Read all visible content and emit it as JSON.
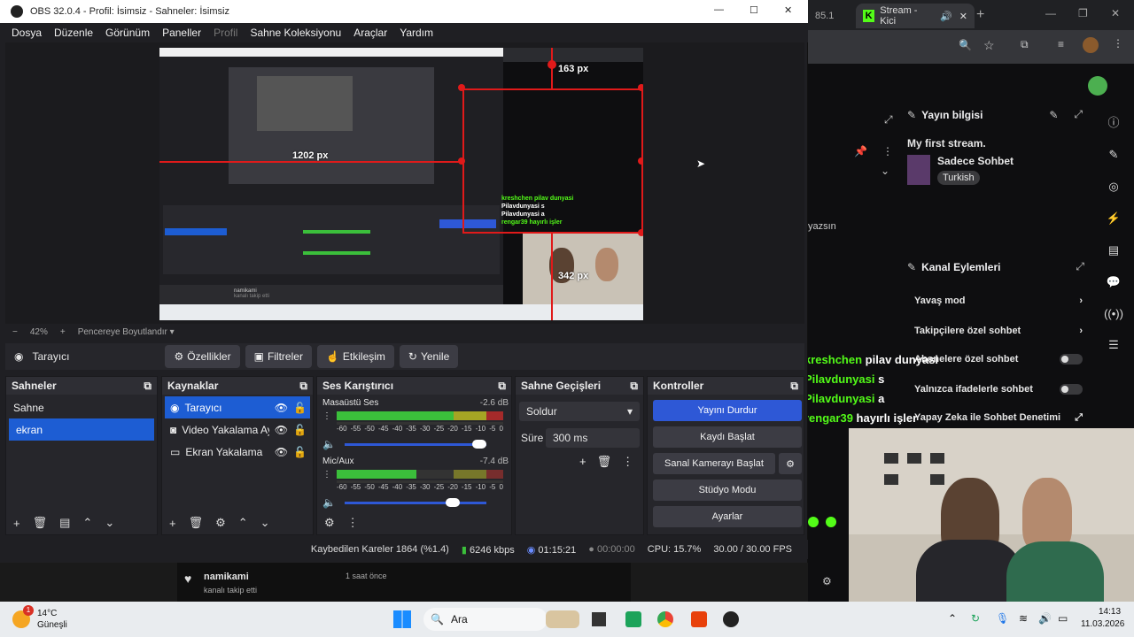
{
  "obs": {
    "window_title": "OBS 32.0.4 - Profil: İsimsiz - Sahneler: İsimsiz",
    "menu": [
      "Dosya",
      "Düzenle",
      "Görünüm",
      "Paneller",
      "Profil",
      "Sahne Koleksiyonu",
      "Araçlar",
      "Yardım"
    ],
    "preview": {
      "px_top": "163 px",
      "px_left": "1202 px",
      "px_bottom": "342 px",
      "nested_chat": [
        "kreshchen pilav dunyasi",
        "Pilavdunyasi s",
        "Pilavdunyasi a",
        "rengar39 hayırlı işler"
      ],
      "nested_follow": "namikami",
      "nested_follow_sub": "kanalı takip etti"
    },
    "zoom": {
      "minus": "−",
      "level": "42%",
      "plus": "+",
      "fit_label": "Pencereye Boyutlandır"
    },
    "source_toolbar": {
      "selected_source": "Tarayıcı",
      "properties": "Özellikler",
      "filters": "Filtreler",
      "interact": "Etkileşim",
      "refresh": "Yenile"
    },
    "scenes": {
      "title": "Sahneler",
      "items": [
        {
          "label": "Sahne",
          "selected": false
        },
        {
          "label": "ekran",
          "selected": true
        }
      ]
    },
    "sources": {
      "title": "Kaynaklar",
      "items": [
        {
          "label": "Tarayıcı",
          "icon": "globe-icon",
          "selected": true
        },
        {
          "label": "Video Yakalama Ay",
          "icon": "camera-icon",
          "selected": false
        },
        {
          "label": "Ekran Yakalama",
          "icon": "monitor-icon",
          "selected": false
        }
      ]
    },
    "mixer": {
      "title": "Ses Karıştırıcı",
      "channels": [
        {
          "name": "Masaüstü Ses",
          "db": "-2.6 dB",
          "level": 0.2,
          "volume": 0.88
        },
        {
          "name": "Mic/Aux",
          "db": "-7.4 dB",
          "level": 0.48,
          "volume": 0.72
        }
      ],
      "scale": [
        "-60",
        "-55",
        "-50",
        "-45",
        "-40",
        "-35",
        "-30",
        "-25",
        "-20",
        "-15",
        "-10",
        "-5",
        "0"
      ]
    },
    "transitions": {
      "title": "Sahne Geçişleri",
      "type": "Soldur",
      "duration_label": "Süre",
      "duration_value": "300 ms"
    },
    "controls": {
      "title": "Kontroller",
      "stop_stream": "Yayını Durdur",
      "start_record": "Kaydı Başlat",
      "virtual_cam": "Sanal Kamerayı Başlat",
      "studio_mode": "Stüdyo Modu",
      "settings": "Ayarlar"
    },
    "status": {
      "dropped_frames": "Kaybedilen Kareler 1864 (%1.4)",
      "bitrate": "6246 kbps",
      "stream_time": "01:15:21",
      "record_time": "00:00:00",
      "cpu": "CPU: 15.7%",
      "fps": "30.00 / 30.00 FPS"
    }
  },
  "browser": {
    "tab_partial": "85.1",
    "tab_title": "Stream - Kici",
    "stream_info": {
      "title": "Yayın bilgisi",
      "stream_name": "My first stream.",
      "category": "Sadece Sohbet",
      "tag": "Turkish"
    },
    "channel_actions": {
      "title": "Kanal Eylemleri",
      "items": [
        {
          "label": "Yavaş mod",
          "control": "chevron"
        },
        {
          "label": "Takipçilere özel sohbet",
          "control": "chevron"
        },
        {
          "label": "Abonelere özel sohbet",
          "control": "toggle"
        },
        {
          "label": "Yalnızca ifadelerle sohbet",
          "control": "toggle"
        },
        {
          "label": "Yapay Zeka ile Sohbet Denetimi",
          "control": "external"
        }
      ]
    },
    "chat_fragment": "yazsın",
    "chat": [
      {
        "user": "kreshchen",
        "text": "pilav dunyasi"
      },
      {
        "user": "Pilavdunyasi",
        "text": "s"
      },
      {
        "user": "Pilavdunyasi",
        "text": "a"
      },
      {
        "user": "rengar39",
        "text": "hayırlı işler"
      }
    ],
    "follow": {
      "user": "namikami",
      "sub": "kanalı takip etti",
      "time": "1 saat önce"
    }
  },
  "taskbar": {
    "weather_temp": "14°C",
    "weather_desc": "Güneşli",
    "weather_badge": "1",
    "search_label": "Ara",
    "time": "14:13",
    "date": "11.03.2026"
  },
  "colors": {
    "accent_blue": "#2e58d6",
    "select_blue": "#1d5dd3",
    "kick_green": "#53fc18",
    "guide_red": "#e01a1a"
  }
}
